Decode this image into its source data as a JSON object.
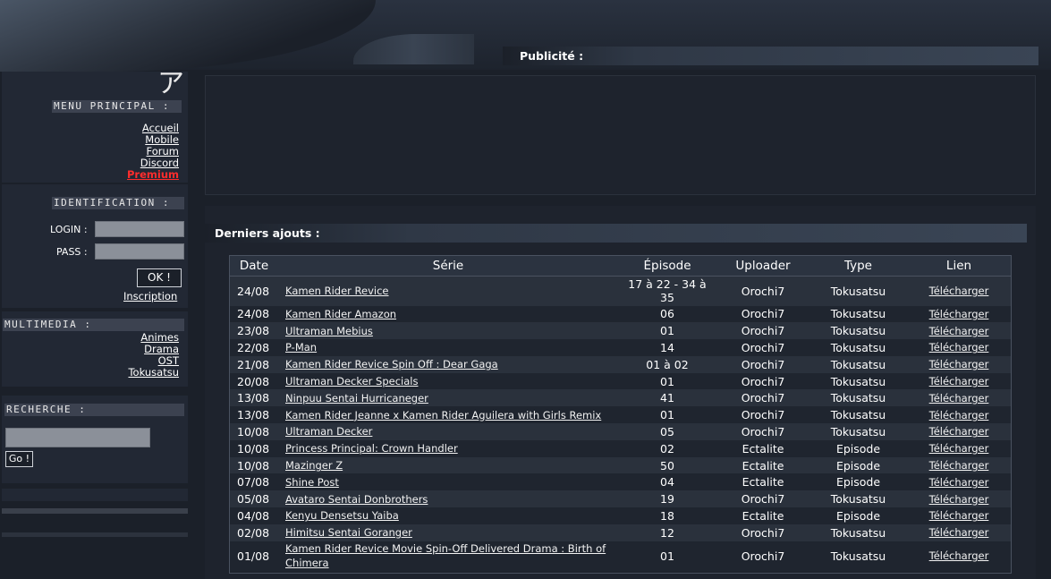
{
  "header": {
    "logo_glyph": "ア",
    "ad_title": "Publicité :"
  },
  "sidebar": {
    "menu": {
      "title": "MENU PRINCIPAL :",
      "items": [
        {
          "label": "Accueil"
        },
        {
          "label": "Mobile"
        },
        {
          "label": "Forum"
        },
        {
          "label": "Discord"
        },
        {
          "label": "Premium"
        }
      ]
    },
    "login": {
      "title": "IDENTIFICATION :",
      "login_label": "LOGIN :",
      "pass_label": "PASS :",
      "ok_button": "OK !",
      "register_link": "Inscription"
    },
    "multimedia": {
      "title": "MULTIMEDIA :",
      "items": [
        {
          "label": "Animes"
        },
        {
          "label": "Drama"
        },
        {
          "label": "OST"
        },
        {
          "label": "Tokusatsu"
        }
      ]
    },
    "search": {
      "title": "RECHERCHE :",
      "go_button": "Go !"
    }
  },
  "main": {
    "latest_title": "Derniers ajouts :",
    "table": {
      "headers": [
        "Date",
        "Série",
        "Épisode",
        "Uploader",
        "Type",
        "Lien"
      ],
      "rows": [
        {
          "date": "24/08",
          "serie": "Kamen Rider Revice",
          "episode": "17 à 22 - 34 à 35",
          "uploader": "Orochi7",
          "type": "Tokusatsu",
          "lien": "Télécharger"
        },
        {
          "date": "24/08",
          "serie": "Kamen Rider Amazon",
          "episode": "06",
          "uploader": "Orochi7",
          "type": "Tokusatsu",
          "lien": "Télécharger"
        },
        {
          "date": "23/08",
          "serie": "Ultraman Mebius",
          "episode": "01",
          "uploader": "Orochi7",
          "type": "Tokusatsu",
          "lien": "Télécharger"
        },
        {
          "date": "22/08",
          "serie": "P-Man",
          "episode": "14",
          "uploader": "Orochi7",
          "type": "Tokusatsu",
          "lien": "Télécharger"
        },
        {
          "date": "21/08",
          "serie": "Kamen Rider Revice Spin Off : Dear Gaga",
          "episode": "01 à 02",
          "uploader": "Orochi7",
          "type": "Tokusatsu",
          "lien": "Télécharger"
        },
        {
          "date": "20/08",
          "serie": "Ultraman Decker Specials",
          "episode": "01",
          "uploader": "Orochi7",
          "type": "Tokusatsu",
          "lien": "Télécharger"
        },
        {
          "date": "13/08",
          "serie": "Ninpuu Sentai Hurricaneger",
          "episode": "41",
          "uploader": "Orochi7",
          "type": "Tokusatsu",
          "lien": "Télécharger"
        },
        {
          "date": "13/08",
          "serie": "Kamen Rider Jeanne x Kamen Rider Aguilera with Girls Remix",
          "episode": "01",
          "uploader": "Orochi7",
          "type": "Tokusatsu",
          "lien": "Télécharger"
        },
        {
          "date": "10/08",
          "serie": "Ultraman Decker",
          "episode": "05",
          "uploader": "Orochi7",
          "type": "Tokusatsu",
          "lien": "Télécharger"
        },
        {
          "date": "10/08",
          "serie": "Princess Principal: Crown Handler",
          "episode": "02",
          "uploader": "Ectalite",
          "type": "Episode",
          "lien": "Télécharger"
        },
        {
          "date": "10/08",
          "serie": "Mazinger Z",
          "episode": "50",
          "uploader": "Ectalite",
          "type": "Episode",
          "lien": "Télécharger"
        },
        {
          "date": "07/08",
          "serie": "Shine Post",
          "episode": "04",
          "uploader": "Ectalite",
          "type": "Episode",
          "lien": "Télécharger"
        },
        {
          "date": "05/08",
          "serie": "Avataro Sentai Donbrothers",
          "episode": "19",
          "uploader": "Orochi7",
          "type": "Tokusatsu",
          "lien": "Télécharger"
        },
        {
          "date": "04/08",
          "serie": "Kenyu Densetsu Yaiba",
          "episode": "18",
          "uploader": "Ectalite",
          "type": "Episode",
          "lien": "Télécharger"
        },
        {
          "date": "02/08",
          "serie": "Himitsu Sentai Goranger",
          "episode": "12",
          "uploader": "Orochi7",
          "type": "Tokusatsu",
          "lien": "Télécharger"
        },
        {
          "date": "01/08",
          "serie": "Kamen Rider Revice Movie Spin-Off Delivered Drama : Birth of Chimera",
          "episode": "01",
          "uploader": "Orochi7",
          "type": "Tokusatsu",
          "lien": "Télécharger"
        }
      ]
    }
  },
  "colors": {
    "background": "#1b2029",
    "panel": "#222834",
    "premium": "#ff2d2d",
    "row_odd": "#2a313c",
    "row_even": "#1f252f"
  }
}
